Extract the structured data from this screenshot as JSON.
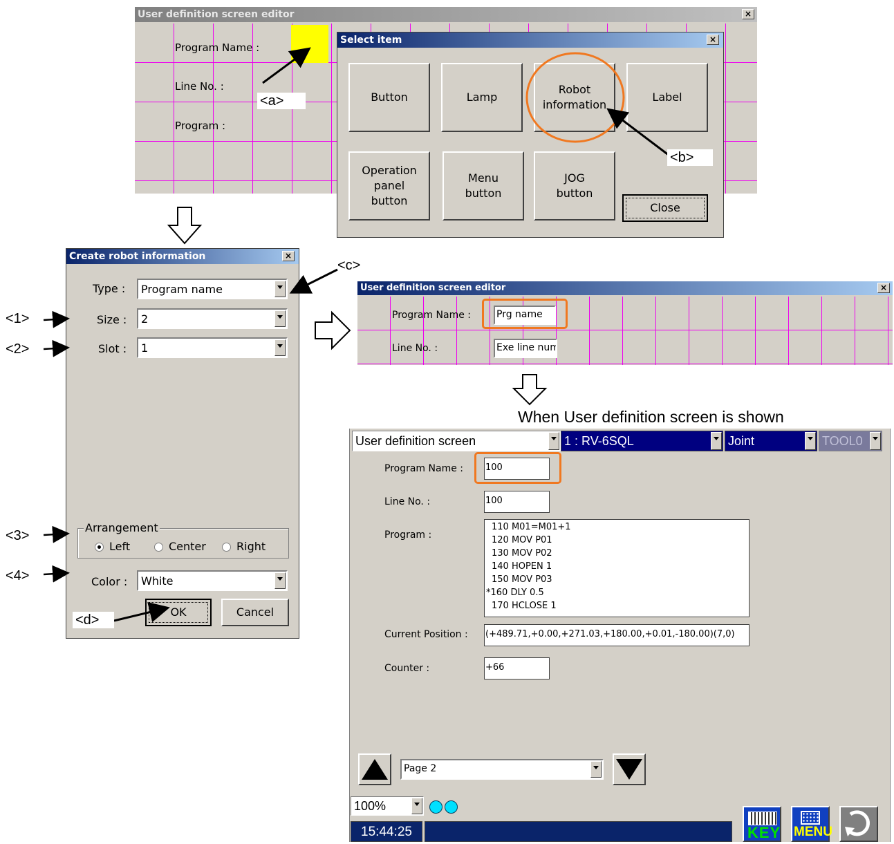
{
  "editor_top": {
    "title": "User definition screen editor",
    "close": "×",
    "labels": [
      "Program Name :",
      "Line No. :",
      "Program :"
    ]
  },
  "select_item": {
    "title": "Select item",
    "close": "×",
    "buttons": [
      "Button",
      "Lamp",
      "Robot\ninformation",
      "Label",
      "Operation\npanel\nbutton",
      "Menu\nbutton",
      "JOG\nbutton"
    ],
    "close_button": "Close"
  },
  "create_robot_info": {
    "title": "Create robot information",
    "close": "×",
    "type_label": "Type :",
    "type_value": "Program name",
    "size_label": "Size :",
    "size_value": "2",
    "slot_label": "Slot :",
    "slot_value": "1",
    "arrangement_label": "Arrangement",
    "arrangement_options": [
      "Left",
      "Center",
      "Right"
    ],
    "arrangement_selected": "Left",
    "color_label": "Color :",
    "color_value": "White",
    "ok_label": "OK",
    "cancel_label": "Cancel"
  },
  "editor_mid": {
    "title": "User definition screen editor",
    "close": "×",
    "labels": [
      "Program Name :",
      "Line No. :"
    ],
    "fields": [
      "Prg name",
      "Exe line num"
    ]
  },
  "caption": "When User definition screen is shown",
  "runtime": {
    "screen_select": "User definition screen",
    "robot_select": "1 : RV-6SQL",
    "jog_select": "Joint",
    "tool_select": "TOOL0",
    "program_name_label": "Program Name :",
    "program_name_value": "100",
    "line_no_label": "Line No. :",
    "line_no_value": "100",
    "program_label": "Program :",
    "program_lines": [
      "110 M01=M01+1",
      "120 MOV P01",
      "130 MOV P02",
      "140 HOPEN 1",
      "150 MOV P03",
      "*160 DLY 0.5",
      "170 HCLOSE 1"
    ],
    "current_position_label": "Current Position :",
    "current_position_value": "(+489.71,+0.00,+271.03,+180.00,+0.01,-180.00)(7,0)",
    "counter_label": "Counter :",
    "counter_value": "+66",
    "page_select": "Page 2",
    "zoom_select": "100%",
    "time": "15:44:25",
    "key_label": "KEY",
    "menu_label": "MENU"
  },
  "callouts": {
    "a": "<a>",
    "b": "<b>",
    "c": "<c>",
    "d": "<d>",
    "n1": "<1>",
    "n2": "<2>",
    "n3": "<3>",
    "n4": "<4>"
  },
  "colors": {
    "accent_orange": "#f07820",
    "grid_magenta": "#ee00ee",
    "highlight_yellow": "#ffff00",
    "navy": "#0a246a"
  }
}
